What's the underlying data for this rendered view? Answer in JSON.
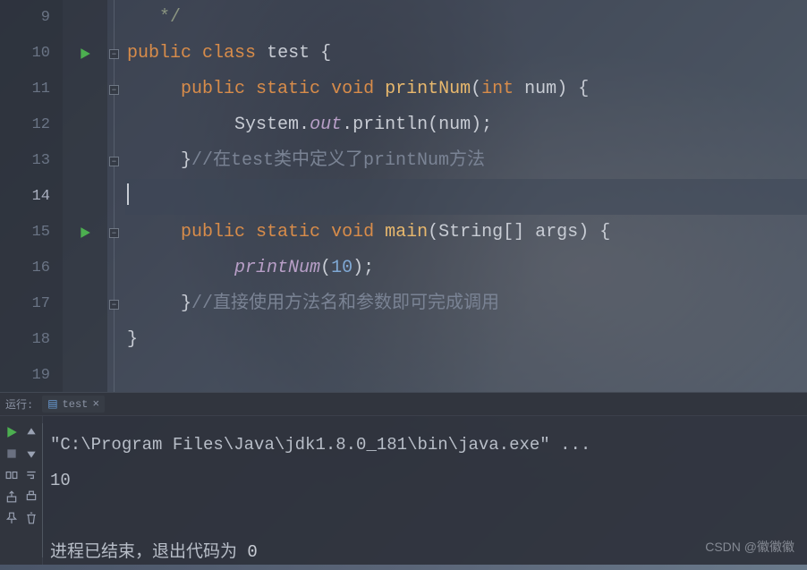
{
  "gutter": {
    "lines": [
      "9",
      "10",
      "11",
      "12",
      "13",
      "14",
      "15",
      "16",
      "17",
      "18",
      "19"
    ],
    "active_line": "14"
  },
  "code": {
    "line9_comment": "*/",
    "kw_public": "public",
    "kw_class": "class",
    "kw_static": "static",
    "kw_void": "void",
    "kw_int": "int",
    "class_name": "test",
    "method_printNum": "printNum",
    "method_main": "main",
    "param_num": "num",
    "param_args": "args",
    "type_String": "String",
    "sys": "System",
    "out": "out",
    "println": "println",
    "call_printNum": "printNum",
    "literal_10": "10",
    "comment13": "//在test类中定义了printNum方法",
    "comment17": "//直接使用方法名和参数即可完成调用"
  },
  "run": {
    "label": "运行:",
    "tab_name": "test",
    "output_cmd": "\"C:\\Program Files\\Java\\jdk1.8.0_181\\bin\\java.exe\" ...",
    "output_val": "10",
    "exit_prefix": "进程已结束，退出代码为 ",
    "exit_code": "0"
  },
  "watermark": "CSDN @徽徽徽"
}
